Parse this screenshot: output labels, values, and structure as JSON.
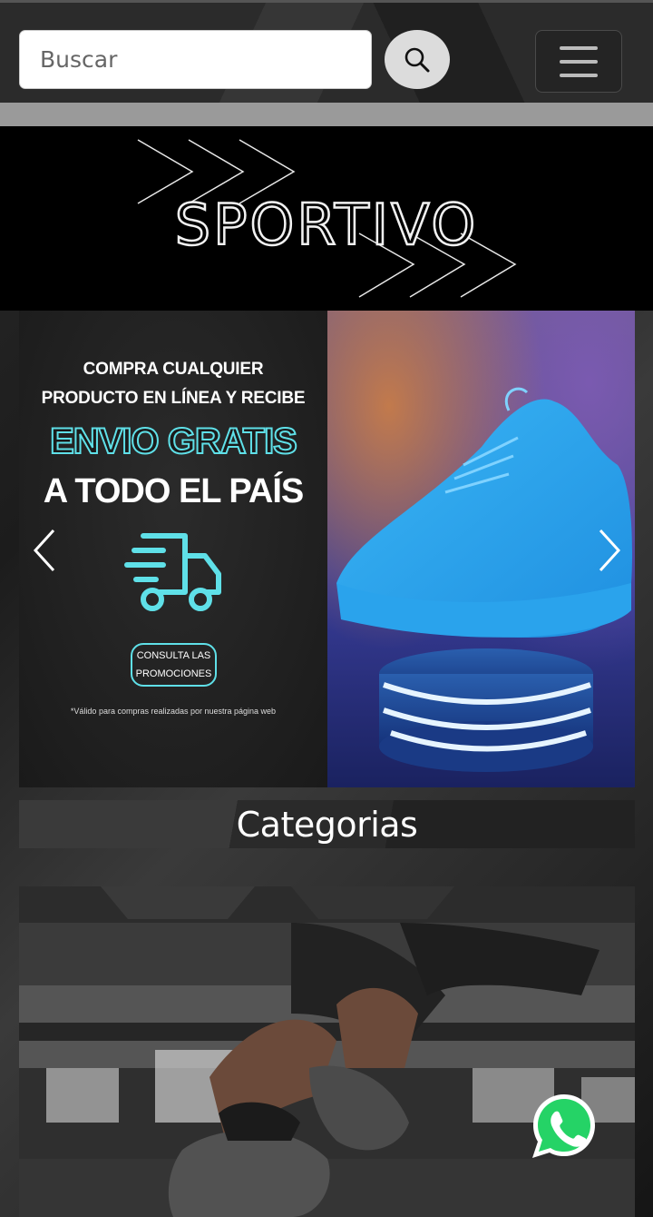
{
  "search": {
    "placeholder": "Buscar"
  },
  "icons": {
    "search": "search-icon",
    "menu": "hamburger-menu-icon",
    "truck": "delivery-truck-icon",
    "prev": "chevron-left-icon",
    "next": "chevron-right-icon",
    "whatsapp": "whatsapp-icon"
  },
  "brand": {
    "logo_text": "SPORTIVO"
  },
  "banner": {
    "line1": "COMPRA CUALQUIER",
    "line2": "PRODUCTO EN LÍNEA Y RECIBE",
    "line3": "ENVIO GRATIS",
    "line4": "A TODO EL PAÍS",
    "button_line1": "CONSULTA LAS",
    "button_line2": "PROMOCIONES",
    "note": "*Válido para compras realizadas por nuestra página web"
  },
  "categories": {
    "title": "Categorias"
  },
  "colors": {
    "accent": "#5fe0e8",
    "header_bg": "#2b2b2b",
    "logo_bg": "#000000",
    "whatsapp": "#25d366"
  }
}
